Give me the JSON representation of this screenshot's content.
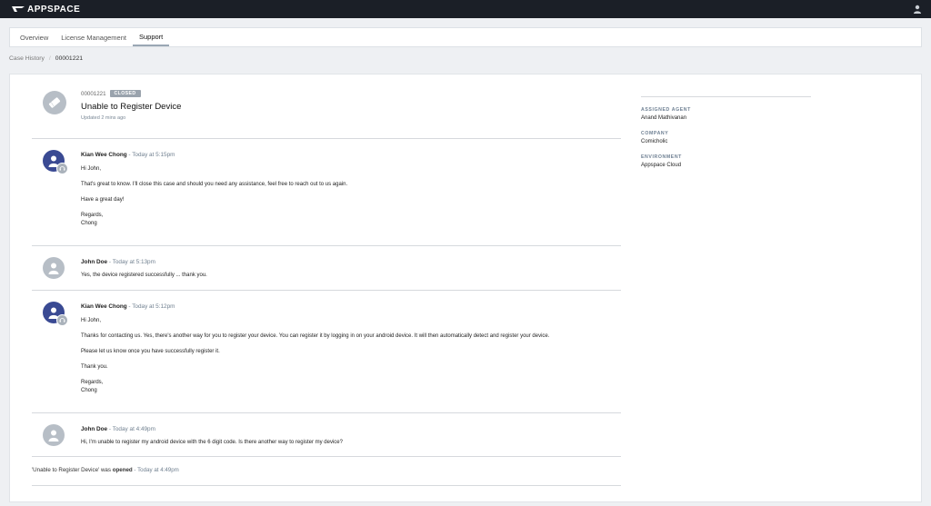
{
  "app": {
    "logo_text": "APPSPACE"
  },
  "tabs": [
    {
      "label": "Overview",
      "active": false
    },
    {
      "label": "License Management",
      "active": false
    },
    {
      "label": "Support",
      "active": true
    }
  ],
  "breadcrumb": {
    "parent": "Case History",
    "separator": "/",
    "current": "00001221"
  },
  "case": {
    "id": "00001221",
    "status": "CLOSED",
    "title": "Unable to Register Device",
    "updated": "Updated 2 mins ago"
  },
  "messages": [
    {
      "author": "Kian Wee Chong",
      "time": " - Today at 5:15pm",
      "lines": [
        "Hi John,",
        "",
        "That's great to know. I'll close this case and should you need any assistance, feel free to reach out to us again.",
        "",
        "Have a great day!",
        "",
        "Regards,",
        "Chong"
      ]
    },
    {
      "author": "John Doe",
      "time": " - Today at 5:13pm",
      "lines": [
        "Yes, the device registered successfully ... thank you."
      ]
    },
    {
      "author": "Kian Wee Chong",
      "time": " - Today at 5:12pm",
      "lines": [
        "Hi John,",
        "",
        "Thanks for contacting us. Yes, there's another way for you to register your device. You can register it by logging in on your android device. It will then automatically detect and register your device.",
        "",
        "Please let us know once you have successfully register it.",
        "",
        "Thank you.",
        "",
        "Regards,",
        "Chong"
      ]
    },
    {
      "author": "John Doe",
      "time": " - Today at 4:49pm",
      "lines": [
        "Hi, I'm unable to register my android device with the 6 digit code. Is there another way to register my device?"
      ]
    }
  ],
  "system_event": {
    "prefix": "'Unable to Register Device' was ",
    "action": "opened",
    "time": " - Today at 4:49pm"
  },
  "details": {
    "assigned_agent_label": "ASSIGNED AGENT",
    "assigned_agent": "Anand Mathivanan",
    "company_label": "COMPANY",
    "company": "Comicholic",
    "environment_label": "ENVIRONMENT",
    "environment": "Appspace Cloud"
  },
  "colors": {
    "topbar": "#1b1f27",
    "agent_avatar": "#3a4a93",
    "user_avatar": "#b7bec6",
    "badge": "#9aa3ad",
    "muted_blue": "#6f7f8f"
  }
}
